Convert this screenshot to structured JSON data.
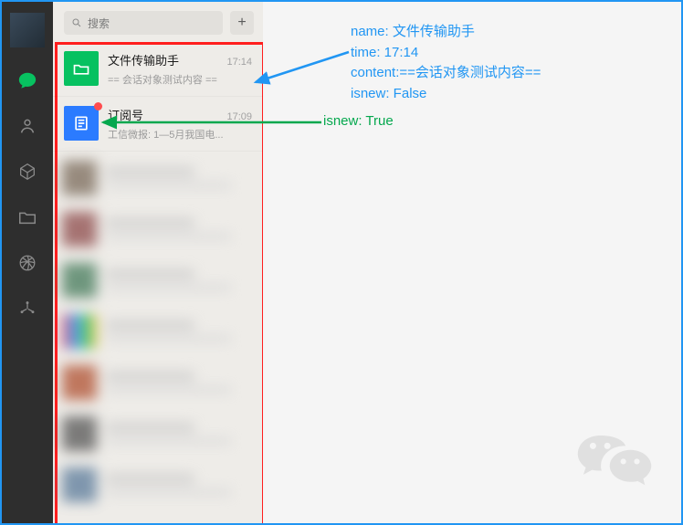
{
  "nav": {
    "items": [
      {
        "name": "chat",
        "active": true
      },
      {
        "name": "contacts",
        "active": false
      },
      {
        "name": "collect",
        "active": false
      },
      {
        "name": "files",
        "active": false
      },
      {
        "name": "moments",
        "active": false
      },
      {
        "name": "mini",
        "active": false
      }
    ]
  },
  "search": {
    "placeholder": "搜索"
  },
  "add_label": "+",
  "conversations": [
    {
      "name": "文件传输助手",
      "time": "17:14",
      "preview": "== 会话对象测试内容 ==",
      "isnew": false,
      "icon": "file"
    },
    {
      "name": "订阅号",
      "time": "17:09",
      "preview": "工信微报: 1—5月我国电...",
      "isnew": true,
      "icon": "sub"
    }
  ],
  "annotation": {
    "line1": "name: 文件传输助手",
    "line2": "time: 17:14",
    "line3": "content:==会话对象测试内容==",
    "line4": "isnew: False",
    "green": "isnew: True"
  }
}
